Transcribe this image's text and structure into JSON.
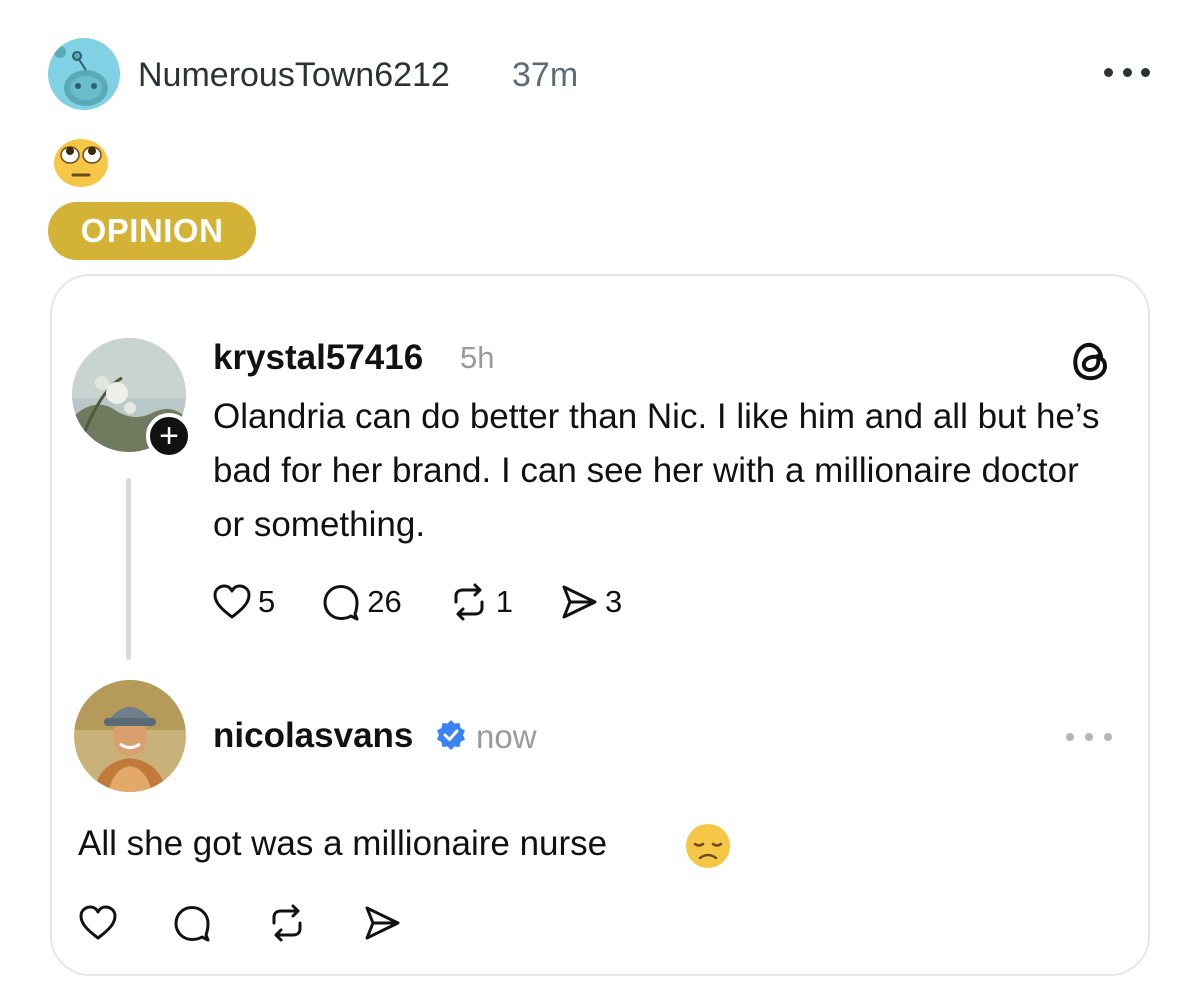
{
  "reddit_post": {
    "username": "NumerousTown6212",
    "time": "37m",
    "avatar_icon": "snoo-avatar-icon",
    "more_icon": "more-dots-icon",
    "body_emoji": "🙄",
    "flair": "OPINION",
    "flair_color": "#d4b236"
  },
  "threads_screenshot": {
    "logo_icon": "threads-logo-icon",
    "original_post": {
      "username": "krystal57416",
      "time": "5h",
      "text": "Olandria can do better than Nic. I like him and all but he’s bad for her brand. I can see her with a millionaire doctor or something.",
      "likes": "5",
      "comments": "26",
      "reposts": "1",
      "shares": "3"
    },
    "reply": {
      "username": "nicolasvans",
      "verified": true,
      "verified_color": "#3b82f6",
      "time": "now",
      "text": "All she got was a millionaire nurse",
      "emoji": "😞"
    }
  }
}
